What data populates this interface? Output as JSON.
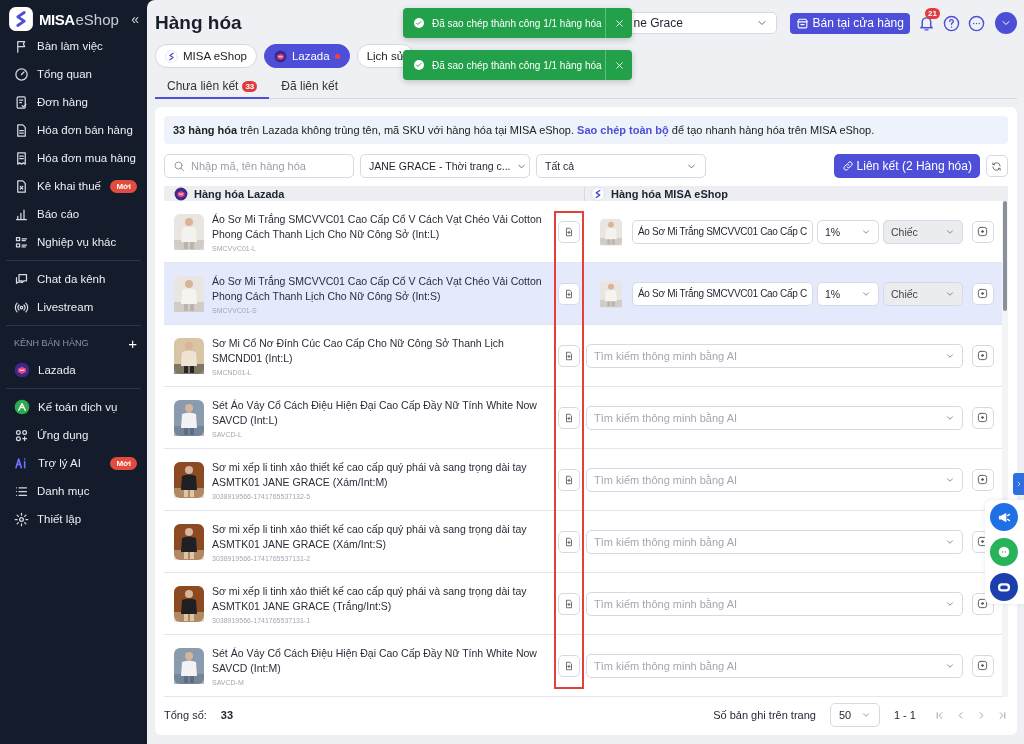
{
  "sidebar": {
    "logo": {
      "brand": "MISA",
      "product": "eShop"
    },
    "collapse": "«",
    "groups": [
      {
        "items": [
          {
            "label": "Bàn làm việc"
          },
          {
            "label": "Tổng quan"
          },
          {
            "label": "Đơn hàng"
          },
          {
            "label": "Hóa đơn bán hàng"
          },
          {
            "label": "Hóa đơn mua hàng"
          },
          {
            "label": "Kê khai thuế",
            "badge": "Mới"
          },
          {
            "label": "Báo cáo"
          },
          {
            "label": "Nghiệp vụ khác"
          }
        ]
      },
      {
        "items": [
          {
            "label": "Chat đa kênh"
          },
          {
            "label": "Livestream"
          }
        ]
      },
      {
        "title": "KÊNH BÁN HÀNG",
        "add": "+",
        "items": [
          {
            "label": "Lazada"
          }
        ]
      },
      {
        "items": [
          {
            "label": "Kế toán dịch vụ"
          },
          {
            "label": "Ứng dụng"
          },
          {
            "label": "Trợ lý AI",
            "badge": "Mới"
          },
          {
            "label": "Danh mục"
          },
          {
            "label": "Thiết lập"
          }
        ]
      }
    ]
  },
  "header": {
    "title": "Hàng hóa",
    "store": "ne Grace",
    "sell_button": "Bán tại cửa hàng",
    "notifications": "21"
  },
  "toasts": [
    {
      "message": "Đã sao chép thành công 1/1 hàng hóa"
    },
    {
      "message": "Đã sao chép thành công 1/1 hàng hóa"
    }
  ],
  "channel_tabs": [
    {
      "label": "MISA eShop",
      "selected": false
    },
    {
      "label": "Lazada",
      "selected": true
    },
    {
      "label": "Lịch sử",
      "selected": false
    }
  ],
  "sub_tabs": [
    {
      "label": "Chưa liên kết",
      "count": "33",
      "selected": true
    },
    {
      "label": "Đã liên kết",
      "selected": false
    }
  ],
  "banner": {
    "text": "**33 hàng hóa** trên Lazada không trùng tên, mã SKU với hàng hóa tại MISA eShop.",
    "link": "Sao chép toàn bộ",
    "text_after": "để tạo nhanh hàng hóa trên MISA eShop."
  },
  "filters": {
    "search": {
      "placeholder": "Nhập mã, tên hàng hóa"
    },
    "shop": "JANE GRACE - Thời trang c...",
    "status": "Tất cả",
    "link_button": "Liên kết (2 Hàng hóa)"
  },
  "table": {
    "columns": [
      "Hàng hóa Lazada",
      "Hàng hóa MISA eShop"
    ],
    "rows": [
      {
        "name": "Áo Sơ Mi Trắng SMCVVC01 Cao Cấp Cổ V Cách Vạt Chéo Vải Cotton Phong Cách Thanh Lịch Cho Nữ Công Sở (Int:L)",
        "sku": "SMCVVC01-L",
        "selected": false,
        "match": {
          "kind": "matched",
          "name": "Áo Sơ Mi Trắng SMCVVC01 Cao Cấp C",
          "tax": "1%",
          "unit": "Chiếc"
        }
      },
      {
        "name": "Áo Sơ Mi Trắng SMCVVC01 Cao Cấp Cổ V Cách Vạt Chéo Vải Cotton Phong Cách Thanh Lịch Cho Nữ Công Sở (Int:S)",
        "sku": "SMCVVC01-S",
        "selected": true,
        "match": {
          "kind": "matched",
          "name": "Áo Sơ Mi Trắng SMCVVC01 Cao Cấp C",
          "tax": "1%",
          "unit": "Chiếc"
        }
      },
      {
        "name": "Sơ Mi Cổ Nơ Đính Cúc Cao Cấp Cho Nữ Công Sở Thanh Lịch SMCND01 (Int:L)",
        "sku": "SMCND01-L",
        "selected": false,
        "match": {
          "kind": "search",
          "placeholder": "Tìm kiếm thông minh bằng AI"
        }
      },
      {
        "name": "Sét Áo Váy Cổ Cách Điệu Hiện Đại Cao Cấp Đầy Nữ Tính White Now SAVCD (Int:L)",
        "sku": "SAVCD-L",
        "selected": false,
        "match": {
          "kind": "search",
          "placeholder": "Tìm kiếm thông minh bằng AI"
        }
      },
      {
        "name": "Sơ mi xếp li tinh xảo thiết kế cao cấp quý phái và sang trọng dài tay ASMTK01 JANE GRACE (Xám/Int:M)",
        "sku": "3038919566-1741765537132-5",
        "selected": false,
        "match": {
          "kind": "search",
          "placeholder": "Tìm kiếm thông minh bằng AI"
        }
      },
      {
        "name": "Sơ mi xếp li tinh xảo thiết kế cao cấp quý phái và sang trọng dài tay ASMTK01 JANE GRACE (Xám/Int:S)",
        "sku": "3038919566-1741765537131-2",
        "selected": false,
        "match": {
          "kind": "search",
          "placeholder": "Tìm kiếm thông minh bằng AI"
        }
      },
      {
        "name": "Sơ mi xếp li tinh xảo thiết kế cao cấp quý phái và sang trọng dài tay ASMTK01 JANE GRACE (Trắng/Int:S)",
        "sku": "3038919566-1741765537131-1",
        "selected": false,
        "match": {
          "kind": "search",
          "placeholder": "Tìm kiếm thông minh bằng AI"
        }
      },
      {
        "name": "Sét Áo Váy Cổ Cách Điệu Hiện Đại Cao Cấp Đầy Nữ Tính White Now SAVCD (Int:M)",
        "sku": "SAVCD-M",
        "selected": false,
        "match": {
          "kind": "search",
          "placeholder": "Tìm kiếm thông minh bằng AI"
        }
      }
    ]
  },
  "footer": {
    "total_label": "Tổng số:",
    "total": "33",
    "page_size_label": "Số bản ghi trên trang",
    "page_size": "50",
    "range": "1 - 1"
  }
}
